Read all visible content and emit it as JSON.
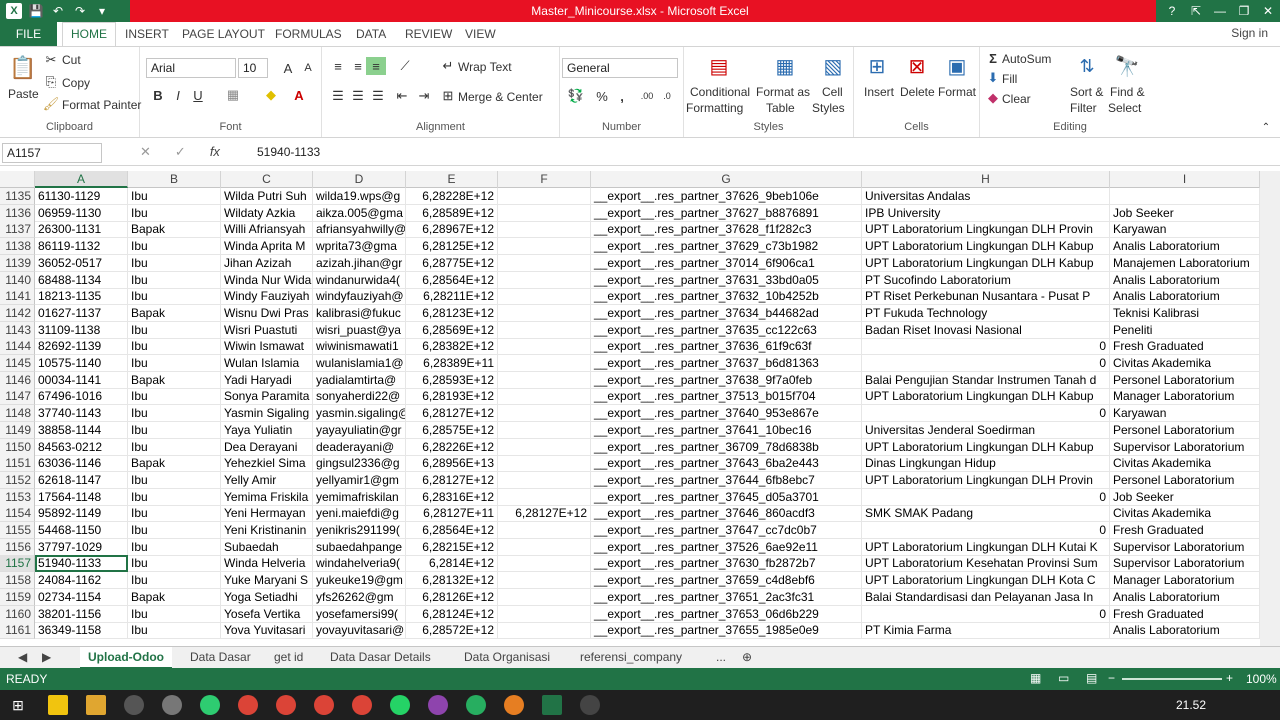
{
  "window": {
    "title": "Master_Minicourse.xlsx - Microsoft Excel",
    "help": "?",
    "minimize": "—",
    "restore": "❐",
    "close": "✕"
  },
  "ribbon_tabs": {
    "file": "FILE",
    "tabs": [
      "HOME",
      "INSERT",
      "PAGE LAYOUT",
      "FORMULAS",
      "DATA",
      "REVIEW",
      "VIEW"
    ],
    "signin": "Sign in"
  },
  "clipboard": {
    "paste": "Paste",
    "cut": "Cut",
    "copy": "Copy",
    "format_painter": "Format Painter",
    "label": "Clipboard"
  },
  "font": {
    "name": "Arial",
    "size": "10",
    "label": "Font",
    "bold": "B",
    "italic": "I",
    "underline": "U"
  },
  "alignment": {
    "wrap_text": "Wrap Text",
    "merge_center": "Merge & Center",
    "label": "Alignment"
  },
  "number": {
    "format": "General",
    "label": "Number",
    "percent": "%",
    "comma": ","
  },
  "styles": {
    "conditional": "Conditional",
    "formatting": "Formatting",
    "format_as": "Format as",
    "table": "Table",
    "cell": "Cell",
    "cell_styles": "Styles",
    "label": "Styles"
  },
  "cells": {
    "insert": "Insert",
    "delete": "Delete",
    "format": "Format",
    "label": "Cells"
  },
  "editing": {
    "autosum": "AutoSum",
    "fill": "Fill",
    "clear": "Clear",
    "sort1": "Sort &",
    "sort2": "Filter",
    "find1": "Find &",
    "find2": "Select",
    "label": "Editing"
  },
  "formula_bar": {
    "name_box": "A1157",
    "fx": "fx",
    "value": "51940-1133"
  },
  "columns": [
    "A",
    "B",
    "C",
    "D",
    "E",
    "F",
    "G",
    "H",
    "I"
  ],
  "rows": [
    {
      "n": "1135",
      "a": "61130-1129",
      "b": "Ibu",
      "c": "Wilda Putri Suh",
      "d": "wilda19.wps@g",
      "e": "6,28228E+12",
      "f": "",
      "g": "__export__.res_partner_37626_9beb106e",
      "h": "Universitas Andalas",
      "i": ""
    },
    {
      "n": "1136",
      "a": "06959-1130",
      "b": "Ibu",
      "c": "Wildaty Azkia",
      "d": "aikza.005@gma",
      "e": "6,28589E+12",
      "f": "",
      "g": "__export__.res_partner_37627_b8876891",
      "h": "IPB University",
      "i": "Job Seeker"
    },
    {
      "n": "1137",
      "a": "26300-1131",
      "b": "Bapak",
      "c": "Willi Afriansyah",
      "d": "afriansyahwilly@",
      "e": "6,28967E+12",
      "f": "",
      "g": "__export__.res_partner_37628_f1f282c3",
      "h": "UPT Laboratorium Lingkungan DLH Provin",
      "i": "Karyawan"
    },
    {
      "n": "1138",
      "a": "86119-1132",
      "b": "Ibu",
      "c": "Winda Aprita M",
      "d": "wprita73@gma",
      "e": "6,28125E+12",
      "f": "",
      "g": "__export__.res_partner_37629_c73b1982",
      "h": "UPT Laboratorium Lingkungan DLH Kabup",
      "i": "Analis Laboratorium"
    },
    {
      "n": "1139",
      "a": "36052-0517",
      "b": "Ibu",
      "c": "Jihan Azizah",
      "d": "azizah.jihan@gr",
      "e": "6,28775E+12",
      "f": "",
      "g": "__export__.res_partner_37014_6f906ca1",
      "h": "UPT Laboratorium Lingkungan DLH Kabup",
      "i": "Manajemen Laboratorium"
    },
    {
      "n": "1140",
      "a": "68488-1134",
      "b": "Ibu",
      "c": "Winda Nur Wida",
      "d": "windanurwida4(",
      "e": "6,28564E+12",
      "f": "",
      "g": "__export__.res_partner_37631_33bd0a05",
      "h": "PT Sucofindo Laboratorium",
      "i": "Analis Laboratorium"
    },
    {
      "n": "1141",
      "a": "18213-1135",
      "b": "Ibu",
      "c": "Windy Fauziyah",
      "d": "windyfauziyah@",
      "e": "6,28211E+12",
      "f": "",
      "g": "__export__.res_partner_37632_10b4252b",
      "h": "PT Riset Perkebunan Nusantara -  Pusat P",
      "i": "Analis Laboratorium"
    },
    {
      "n": "1142",
      "a": "01627-1137",
      "b": "Bapak",
      "c": "Wisnu Dwi Pras",
      "d": "kalibrasi@fukuc",
      "e": "6,28123E+12",
      "f": "",
      "g": "__export__.res_partner_37634_b44682ad",
      "h": "PT Fukuda Technology",
      "i": "Teknisi Kalibrasi"
    },
    {
      "n": "1143",
      "a": "31109-1138",
      "b": "Ibu",
      "c": "Wisri Puastuti",
      "d": "wisri_puast@ya",
      "e": "6,28569E+12",
      "f": "",
      "g": "__export__.res_partner_37635_cc122c63",
      "h": "Badan Riset Inovasi Nasional",
      "i": "Peneliti"
    },
    {
      "n": "1144",
      "a": "82692-1139",
      "b": "Ibu",
      "c": "Wiwin Ismawat",
      "d": "wiwinismawati1",
      "e": "6,28382E+12",
      "f": "",
      "g": "__export__.res_partner_37636_61f9c63f",
      "h": "0",
      "i": "Fresh Graduated"
    },
    {
      "n": "1145",
      "a": "10575-1140",
      "b": "Ibu",
      "c": "Wulan Islamia",
      "d": "wulanislamia1@",
      "e": "6,28389E+11",
      "f": "",
      "g": "__export__.res_partner_37637_b6d81363",
      "h": "0",
      "i": "Civitas Akademika"
    },
    {
      "n": "1146",
      "a": "00034-1141",
      "b": "Bapak",
      "c": "Yadi Haryadi",
      "d": "yadialamtirta@",
      "e": "6,28593E+12",
      "f": "",
      "g": "__export__.res_partner_37638_9f7a0feb",
      "h": "Balai Pengujian Standar Instrumen Tanah d",
      "i": "Personel Laboratorium"
    },
    {
      "n": "1147",
      "a": "67496-1016",
      "b": "Ibu",
      "c": "Sonya Paramita",
      "d": "sonyaherdi22@",
      "e": "6,28193E+12",
      "f": "",
      "g": "__export__.res_partner_37513_b015f704",
      "h": "UPT Laboratorium Lingkungan DLH Kabup",
      "i": "Manager Laboratorium"
    },
    {
      "n": "1148",
      "a": "37740-1143",
      "b": "Ibu",
      "c": "Yasmin Sigaling",
      "d": "yasmin.sigaling@",
      "e": "6,28127E+12",
      "f": "",
      "g": "__export__.res_partner_37640_953e867e",
      "h": "0",
      "i": "Karyawan"
    },
    {
      "n": "1149",
      "a": "38858-1144",
      "b": "Ibu",
      "c": "Yaya Yuliatin",
      "d": "yayayuliatin@gr",
      "e": "6,28575E+12",
      "f": "",
      "g": "__export__.res_partner_37641_10bec16",
      "h": "Universitas Jenderal Soedirman",
      "i": "Personel Laboratorium"
    },
    {
      "n": "1150",
      "a": "84563-0212",
      "b": "Ibu",
      "c": "Dea Derayani",
      "d": "deaderayani@",
      "e": "6,28226E+12",
      "f": "",
      "g": "__export__.res_partner_36709_78d6838b",
      "h": "UPT Laboratorium Lingkungan DLH Kabup",
      "i": "Supervisor Laboratorium"
    },
    {
      "n": "1151",
      "a": "63036-1146",
      "b": "Bapak",
      "c": "Yehezkiel Sima",
      "d": "gingsul2336@g",
      "e": "6,28956E+13",
      "f": "",
      "g": "__export__.res_partner_37643_6ba2e443",
      "h": "Dinas Lingkungan Hidup",
      "i": "Civitas Akademika"
    },
    {
      "n": "1152",
      "a": "62618-1147",
      "b": "Ibu",
      "c": "Yelly Amir",
      "d": "yellyamir1@gm",
      "e": "6,28127E+12",
      "f": "",
      "g": "__export__.res_partner_37644_6fb8ebc7",
      "h": "UPT Laboratorium Lingkungan DLH Provin",
      "i": "Personel Laboratorium"
    },
    {
      "n": "1153",
      "a": "17564-1148",
      "b": "Ibu",
      "c": "Yemima Friskila",
      "d": "yemimafriskilan",
      "e": "6,28316E+12",
      "f": "",
      "g": "__export__.res_partner_37645_d05a3701",
      "h": "0",
      "i": "Job Seeker"
    },
    {
      "n": "1154",
      "a": "95892-1149",
      "b": "Ibu",
      "c": "Yeni Hermayan",
      "d": "yeni.maiefdi@g",
      "e": "6,28127E+11",
      "f": "6,28127E+12",
      "g": "__export__.res_partner_37646_860acdf3",
      "h": "SMK SMAK Padang",
      "i": "Civitas Akademika"
    },
    {
      "n": "1155",
      "a": "54468-1150",
      "b": "Ibu",
      "c": "Yeni Kristinanin",
      "d": "yenikris291199(",
      "e": "6,28564E+12",
      "f": "",
      "g": "__export__.res_partner_37647_cc7dc0b7",
      "h": "0",
      "i": "Fresh Graduated"
    },
    {
      "n": "1156",
      "a": "37797-1029",
      "b": "Ibu",
      "c": "Subaedah",
      "d": "subaedahpange",
      "e": "6,28215E+12",
      "f": "",
      "g": "__export__.res_partner_37526_6ae92e11",
      "h": "UPT Laboratorium Lingkungan DLH Kutai K",
      "i": "Supervisor Laboratorium"
    },
    {
      "n": "1157",
      "a": "51940-1133",
      "b": "Ibu",
      "c": "Winda Helveria",
      "d": "windahelveria9(",
      "e": "6,2814E+12",
      "f": "",
      "g": "__export__.res_partner_37630_fb2872b7",
      "h": "UPT Laboratorium Kesehatan Provinsi Sum",
      "i": "Supervisor Laboratorium"
    },
    {
      "n": "1158",
      "a": "24084-1162",
      "b": "Ibu",
      "c": "Yuke Maryani S",
      "d": "yukeuke19@gm",
      "e": "6,28132E+12",
      "f": "",
      "g": "__export__.res_partner_37659_c4d8ebf6",
      "h": "UPT Laboratorium Lingkungan DLH Kota C",
      "i": "Manager Laboratorium"
    },
    {
      "n": "1159",
      "a": "02734-1154",
      "b": "Bapak",
      "c": "Yoga Setiadhi",
      "d": "yfs26262@gm",
      "e": "6,28126E+12",
      "f": "",
      "g": "__export__.res_partner_37651_2ac3fc31",
      "h": "Balai Standardisasi dan Pelayanan Jasa In",
      "i": "Analis Laboratorium"
    },
    {
      "n": "1160",
      "a": "38201-1156",
      "b": "Ibu",
      "c": "Yosefa Vertika",
      "d": "yosefamersi99(",
      "e": "6,28124E+12",
      "f": "",
      "g": "__export__.res_partner_37653_06d6b229",
      "h": "0",
      "i": "Fresh Graduated"
    },
    {
      "n": "1161",
      "a": "36349-1158",
      "b": "Ibu",
      "c": "Yova Yuvitasari",
      "d": "yovayuvitasari@",
      "e": "6,28572E+12",
      "f": "",
      "g": "__export__.res_partner_37655_1985e0e9",
      "h": "PT Kimia Farma",
      "i": "Analis Laboratorium"
    }
  ],
  "active_row": "1157",
  "sheets": [
    "Upload-Odoo",
    "Data Dasar",
    "get id",
    "Data Dasar Details",
    "Data Organisasi",
    "referensi_company",
    "..."
  ],
  "status": {
    "ready": "READY",
    "zoom": "100%"
  },
  "taskbar": {
    "time": "21.52"
  },
  "colors": {
    "excel_green": "#217346",
    "title_red": "#e81123"
  }
}
